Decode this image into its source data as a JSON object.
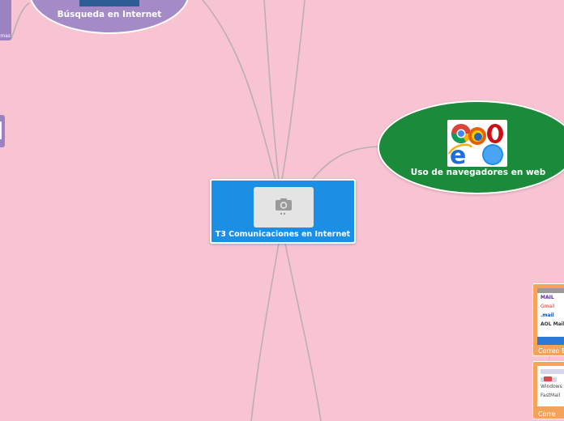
{
  "central": {
    "title": "T3 Comunicaciones en Internet",
    "image_icon": "camera-icon"
  },
  "topics": {
    "browsers": {
      "label": "Uso de navegadores en web",
      "image": "browser-logos-image",
      "color": "#1b8a3a"
    },
    "search": {
      "label": "Búsqueda en Internet",
      "color": "#a48ac6"
    },
    "left_card": {
      "label": "mas"
    },
    "mail1": {
      "caption": "Correo E",
      "lines": [
        "MAIL",
        "Gmail",
        ".mail",
        "AOL Mail"
      ]
    },
    "mail2": {
      "caption": "Corre",
      "lines": [
        "Windows",
        "FastMail"
      ]
    }
  },
  "colors": {
    "background": "#f9c4d2",
    "central": "#1a8fe3",
    "connector": "#b8a8a8",
    "mail_cards": "#f3a35a"
  }
}
